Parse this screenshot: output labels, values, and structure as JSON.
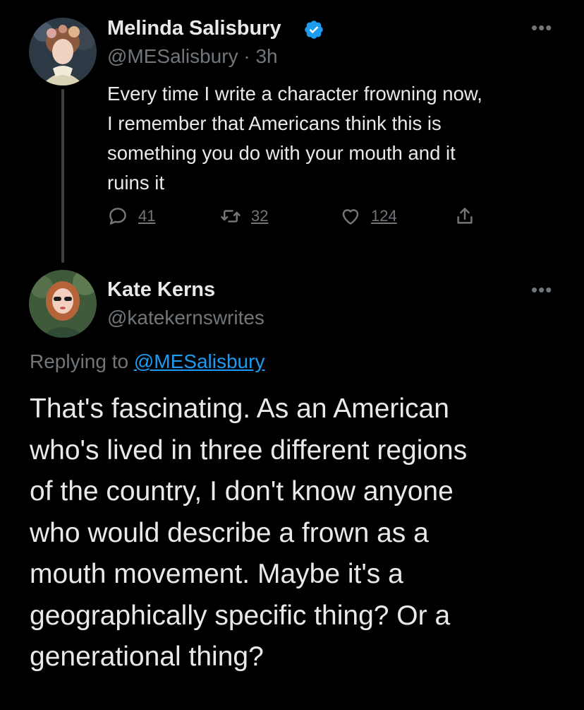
{
  "tweet": {
    "author": {
      "display_name": "Melinda Salisbury",
      "verified": true,
      "verified_icon": "verified-badge-icon",
      "handle": "@MESalisbury",
      "separator": "·",
      "time": "3h"
    },
    "more_icon": "more-options-icon",
    "text_lines": [
      "Every time I write a character frowning now,",
      "I remember that Americans think this is",
      "something you do with your mouth and it",
      "ruins it"
    ],
    "actions": {
      "reply": {
        "icon": "reply-icon",
        "count": "41"
      },
      "retweet": {
        "icon": "retweet-icon",
        "count": "32"
      },
      "like": {
        "icon": "heart-icon",
        "count": "124"
      },
      "share": {
        "icon": "share-icon"
      }
    }
  },
  "reply": {
    "author": {
      "display_name": "Kate Kerns",
      "handle": "@katekernswrites"
    },
    "more_icon": "more-options-icon",
    "replying_prefix": "Replying to",
    "replying_to": "@MESalisbury",
    "text_lines": [
      "That's fascinating. As an American",
      "who's lived in three different regions",
      "of the country, I don't know anyone",
      "who would describe a frown as a",
      "mouth movement. Maybe it's a",
      "geographically specific thing? Or a",
      "generational thing?"
    ]
  },
  "colors": {
    "background": "#000000",
    "text_primary": "#e7e9ea",
    "text_secondary": "#71767b",
    "accent": "#1d9bf0",
    "thread_line": "#3e4144"
  }
}
